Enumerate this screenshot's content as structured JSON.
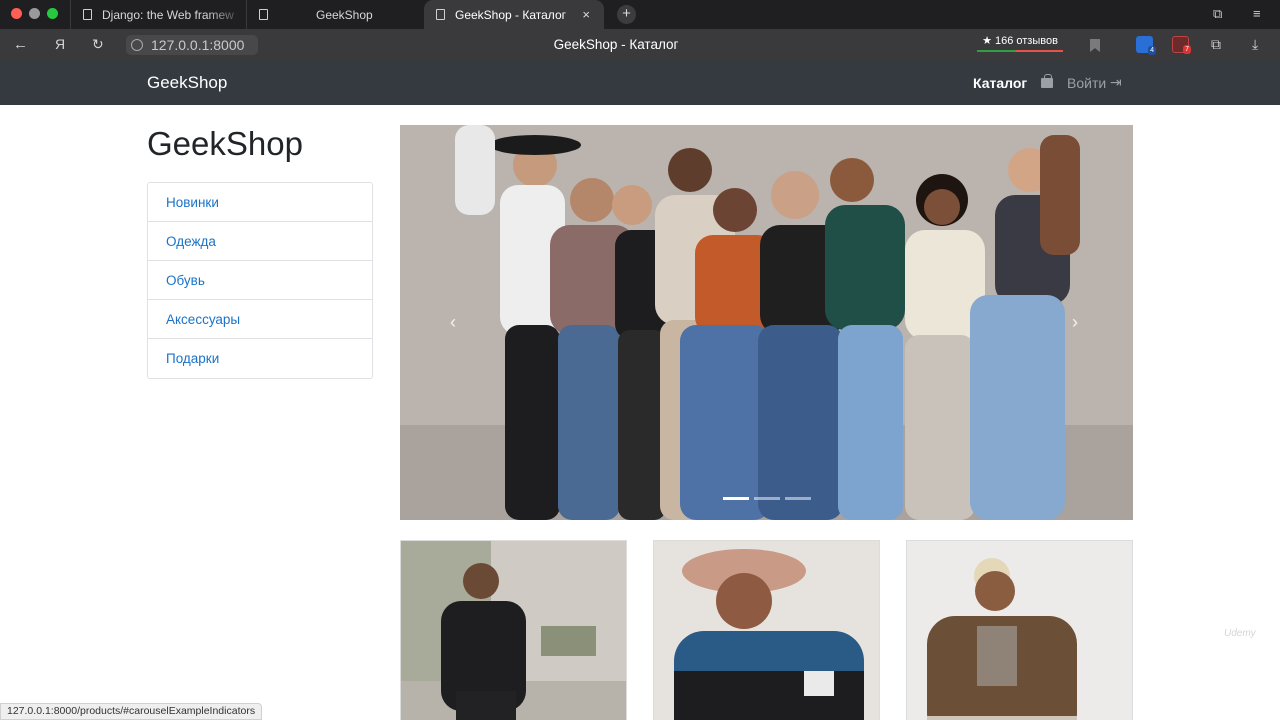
{
  "browser": {
    "tabs": [
      {
        "label": "Django: the Web framew"
      },
      {
        "label": "GeekShop"
      },
      {
        "label": "GeekShop - Каталог"
      }
    ],
    "new_tab_glyph": "+",
    "close_glyph": "×",
    "url": "127.0.0.1:8000",
    "window_title": "GeekShop - Каталог",
    "yandex_glyph": "Я",
    "reviews_label": "★ 166 отзывов",
    "extension_blue_badge": "4",
    "extension_red_badge": "7",
    "status_url": "127.0.0.1:8000/products/#carouselExampleIndicators"
  },
  "navbar": {
    "brand": "GeekShop",
    "catalog_link": "Каталог",
    "login_link": "Войти"
  },
  "page": {
    "title": "GeekShop",
    "categories": [
      {
        "label": "Новинки"
      },
      {
        "label": "Одежда"
      },
      {
        "label": "Обувь"
      },
      {
        "label": "Аксессуары"
      },
      {
        "label": "Подарки"
      }
    ],
    "carousel": {
      "slide_count": 3,
      "active_slide": 1
    },
    "products": [
      {
        "image": "man-black-tracksuit-photo"
      },
      {
        "image": "man-bucket-hat-puffer-photo"
      },
      {
        "image": "man-fleece-jacket-photo"
      }
    ]
  },
  "watermark": "Udemy",
  "colors": {
    "navbar_bg": "#343a40",
    "link": "#1a73c8",
    "browser_chrome": "#1f1f21"
  }
}
